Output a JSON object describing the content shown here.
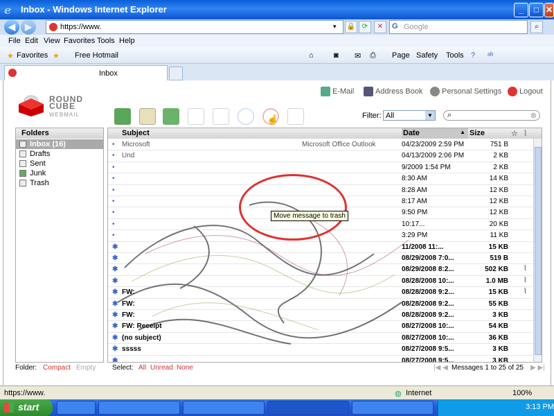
{
  "window": {
    "title": "Inbox - Windows Internet Explorer"
  },
  "address": {
    "url": "https://www.",
    "search_placeholder": "Google"
  },
  "menu": [
    "File",
    "Edit",
    "View",
    "Favorites",
    "Tools",
    "Help"
  ],
  "favorites_bar": {
    "favorites_label": "Favorites",
    "free_hotmail": "Free Hotmail",
    "page_label": "Page",
    "safety_label": "Safety",
    "tools_label": "Tools"
  },
  "tab": {
    "label": "Inbox"
  },
  "app": {
    "logo_line1": "ROUND",
    "logo_line2": "CUBE",
    "logo_sub": "WEBMAIL",
    "email_link": "E-Mail",
    "addressbook_link": "Address Book",
    "settings_link": "Personal Settings",
    "logout_link": "Logout",
    "filter_label": "Filter:",
    "filter_value": "All",
    "tooltip": "Move message to trash"
  },
  "folders": {
    "header": "Folders",
    "items": [
      {
        "label": "Inbox (16)",
        "selected": true
      },
      {
        "label": "Drafts"
      },
      {
        "label": "Sent"
      },
      {
        "label": "Junk"
      },
      {
        "label": "Trash"
      }
    ]
  },
  "messages": {
    "columns": {
      "subject": "Subject",
      "date": "Date",
      "size": "Size"
    },
    "rows": [
      {
        "subject": "Microsoft",
        "from": "Microsoft Office Outlook",
        "date": "04/23/2009 2:59 PM",
        "size": "751 B",
        "unread": false,
        "attach": false
      },
      {
        "subject": "Und",
        "from": "",
        "date": "04/13/2009 2:06 PM",
        "size": "2 KB",
        "unread": false,
        "attach": false
      },
      {
        "subject": "",
        "from": "",
        "date": "9/2009 1:54 PM",
        "size": "2 KB",
        "unread": false,
        "attach": false
      },
      {
        "subject": "",
        "from": "",
        "date": "8:30 AM",
        "size": "14 KB",
        "unread": false,
        "attach": false
      },
      {
        "subject": "",
        "from": "",
        "date": "8:28 AM",
        "size": "12 KB",
        "unread": false,
        "attach": false
      },
      {
        "subject": "",
        "from": "",
        "date": "8:17 AM",
        "size": "12 KB",
        "unread": false,
        "attach": false
      },
      {
        "subject": "",
        "from": "",
        "date": "9:50 PM",
        "size": "12 KB",
        "unread": false,
        "attach": false
      },
      {
        "subject": "",
        "from": "",
        "date": "10:17...",
        "size": "20 KB",
        "unread": false,
        "attach": false
      },
      {
        "subject": "",
        "from": "",
        "date": "3:29 PM",
        "size": "11 KB",
        "unread": false,
        "attach": false
      },
      {
        "subject": "",
        "from": "",
        "date": "11/2008 11:...",
        "size": "15 KB",
        "unread": true,
        "attach": false
      },
      {
        "subject": "",
        "from": "",
        "date": "08/29/2008 7:0...",
        "size": "519 B",
        "unread": true,
        "attach": false
      },
      {
        "subject": "",
        "from": "",
        "date": "08/29/2008 8:2...",
        "size": "502 KB",
        "unread": true,
        "attach": true
      },
      {
        "subject": "",
        "from": "",
        "date": "08/28/2008 10:...",
        "size": "1.0 MB",
        "unread": true,
        "attach": true
      },
      {
        "subject": "FW:",
        "from": "",
        "date": "08/28/2008 9:2...",
        "size": "15 KB",
        "unread": true,
        "attach": true
      },
      {
        "subject": "FW:",
        "from": "",
        "date": "08/28/2008 9:2...",
        "size": "55 KB",
        "unread": true,
        "attach": false
      },
      {
        "subject": "FW:",
        "from": "",
        "date": "08/28/2008 9:2...",
        "size": "3 KB",
        "unread": true,
        "attach": false
      },
      {
        "subject": "FW: Receipt",
        "from": "",
        "date": "08/27/2008 10:...",
        "size": "54 KB",
        "unread": true,
        "attach": false
      },
      {
        "subject": "(no subject)",
        "from": "",
        "date": "08/27/2008 10:...",
        "size": "36 KB",
        "unread": true,
        "attach": false
      },
      {
        "subject": "sssss",
        "from": "",
        "date": "08/27/2008 9:5...",
        "size": "3 KB",
        "unread": true,
        "attach": false
      },
      {
        "subject": "",
        "from": "",
        "date": "08/27/2008 9:5...",
        "size": "3 KB",
        "unread": true,
        "attach": false
      }
    ]
  },
  "page_footer": {
    "folder_label": "Folder:",
    "compact": "Compact",
    "empty": "Empty",
    "select_label": "Select:",
    "all": "All",
    "unread": "Unread",
    "none": "None",
    "count": "Messages 1 to 25 of 25"
  },
  "statusbar": {
    "url": "https://www.",
    "zone": "Internet",
    "zoom": "100%"
  },
  "taskbar": {
    "start": "start",
    "clock": "3:13 PM"
  },
  "colors": {
    "title_blue": "#0a5fd8",
    "accent_red": "#cc3333",
    "annotation_red": "#e03030"
  }
}
